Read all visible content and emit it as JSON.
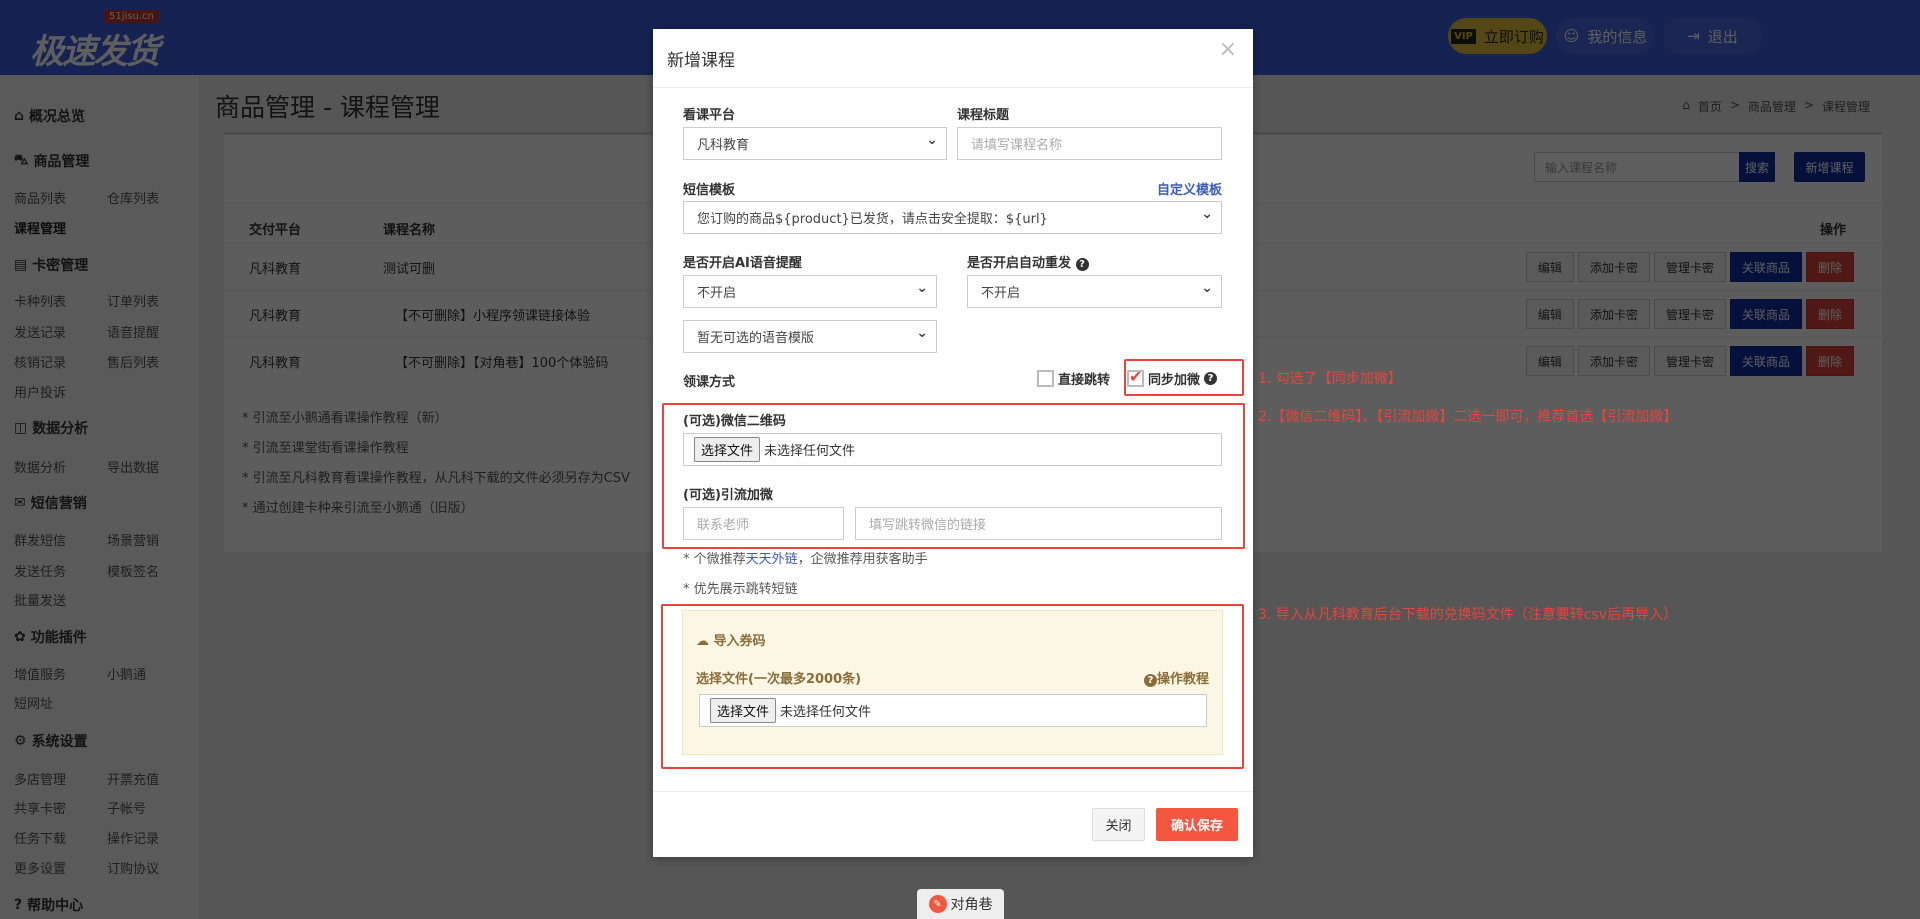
{
  "header": {
    "logo": "极速发货",
    "logo_badge": "51jisu.cn",
    "vip": "VIP",
    "subscribe": "立即订购",
    "my_info": "我的信息",
    "logout": "退出"
  },
  "sidebar": {
    "sections": [
      {
        "title": "概况总览",
        "items": []
      },
      {
        "title": "商品管理",
        "items": [
          "商品列表",
          "仓库列表",
          "课程管理"
        ]
      },
      {
        "title": "卡密管理",
        "items": [
          "卡种列表",
          "订单列表",
          "发送记录",
          "语音提醒",
          "核销记录",
          "售后列表",
          "用户投诉"
        ]
      },
      {
        "title": "数据分析",
        "items": [
          "数据分析",
          "导出数据"
        ]
      },
      {
        "title": "短信营销",
        "items": [
          "群发短信",
          "场景营销",
          "发送任务",
          "模板签名",
          "批量发送"
        ]
      },
      {
        "title": "功能插件",
        "items": [
          "增值服务",
          "小鹅通",
          "短网址"
        ]
      },
      {
        "title": "系统设置",
        "items": [
          "多店管理",
          "开票充值",
          "共享卡密",
          "子帐号",
          "任务下载",
          "操作记录",
          "更多设置",
          "订购协议"
        ]
      },
      {
        "title": "帮助中心",
        "items": []
      }
    ]
  },
  "page": {
    "title": "商品管理 - 课程管理",
    "breadcrumb": [
      "首页",
      "商品管理",
      "课程管理"
    ],
    "search_placeholder": "输入课程名称",
    "search": "搜索",
    "new_course": "新增课程"
  },
  "table": {
    "headers": [
      "交付平台",
      "课程名称",
      "操作"
    ],
    "rows": [
      {
        "platform": "凡科教育",
        "name": "测试可删"
      },
      {
        "platform": "凡科教育",
        "name": "【不可删除】小程序领课链接体验"
      },
      {
        "platform": "凡科教育",
        "name": "【不可删除】【对角巷】100个体验码"
      }
    ],
    "ops": [
      "编辑",
      "添加卡密",
      "管理卡密",
      "关联商品",
      "删除"
    ]
  },
  "notes": [
    "* 引流至小鹅通看课操作教程（新）",
    "* 引流至课堂街看课操作教程",
    "* 引流至凡科教育看课操作教程，从凡科下载的文件必须另存为CSV",
    "* 通过创建卡种来引流至小鹅通（旧版）"
  ],
  "modal": {
    "title": "新增课程",
    "close": "×",
    "platform_label": "看课平台",
    "platform_value": "凡科教育",
    "course_title_label": "课程标题",
    "course_title_placeholder": "请填写课程名称",
    "sms_label": "短信模板",
    "sms_custom": "自定义模板",
    "sms_value": "您订购的商品${product}已发货，请点击安全提取：${url}",
    "ai_label": "是否开启AI语音提醒",
    "ai_value": "不开启",
    "voice_value": "暂无可选的语音模版",
    "resend_label": "是否开启自动重发",
    "resend_value": "不开启",
    "method_label": "领课方式",
    "direct_jump": "直接跳转",
    "sync_wechat": "同步加微",
    "qr_label": "(可选)微信二维码",
    "choose_file": "选择文件",
    "no_file": "未选择任何文件",
    "wechat_label": "(可选)引流加微",
    "teacher_placeholder": "联系老师",
    "link_placeholder": "填写跳转微信的链接",
    "tip1_a": "* 个微推荐",
    "tip1_link": "天天外链",
    "tip1_b": "，企微推荐用获客助手",
    "tip2": "* 优先展示跳转短链",
    "import_title": "导入券码",
    "import_file_label": "选择文件(一次最多2000条)",
    "tutorial": "操作教程",
    "cancel": "关闭",
    "save": "确认保存"
  },
  "annotations": [
    "1. 勾选了【同步加微】",
    "2.【微信二维码】、【引流加微】二选一即可，推荐首选【引流加微】",
    "3. 导入从凡科教育后台下载的兑换码文件（注意要转csv后再导入）"
  ],
  "dock": {
    "label": "对角巷"
  },
  "colors": {
    "header": "#3b5cdb",
    "primary": "#0d2fa0",
    "danger": "#f5563f",
    "annotation": "#e8453c",
    "vip": "#e0c33a"
  }
}
